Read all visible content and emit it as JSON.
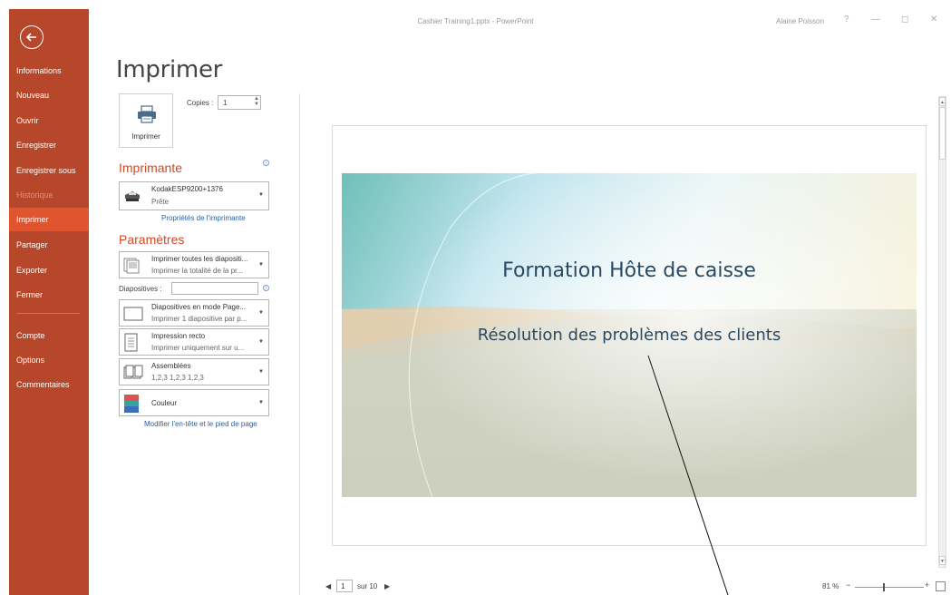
{
  "window": {
    "title": "Cashier Training1.pptx - PowerPoint",
    "user": "Alaine Poisson",
    "help": "?",
    "minimize": "—",
    "restore": "◻",
    "close": "✕"
  },
  "nav": {
    "items": [
      {
        "label": "Informations"
      },
      {
        "label": "Nouveau"
      },
      {
        "label": "Ouvrir"
      },
      {
        "label": "Enregistrer"
      },
      {
        "label": "Enregistrer sous"
      },
      {
        "label": "Historique"
      },
      {
        "label": "Imprimer"
      },
      {
        "label": "Partager"
      },
      {
        "label": "Exporter"
      },
      {
        "label": "Fermer"
      },
      {
        "label": "Compte"
      },
      {
        "label": "Options"
      },
      {
        "label": "Commentaires"
      }
    ]
  },
  "print": {
    "title": "Imprimer",
    "button_label": "Imprimer",
    "copies_label": "Copies :",
    "copies_value": "1"
  },
  "printer": {
    "section_title": "Imprimante",
    "name": "KodakESP9200+1376",
    "status": "Prête",
    "properties_link": "Propriétés de l'imprimante"
  },
  "settings": {
    "section_title": "Paramètres",
    "range_main": "Imprimer toutes les diapositi...",
    "range_sub": "Imprimer la totalité de la pr...",
    "slides_label": "Diapositives :",
    "layout_main": "Diapositives en mode Page...",
    "layout_sub": "Imprimer 1 diapositive par p...",
    "sides_main": "Impression recto",
    "sides_sub": "Imprimer uniquement sur u...",
    "collate_main": "Assemblées",
    "collate_sub": "1,2,3   1,2,3   1,2,3",
    "color_main": "Couleur",
    "header_footer_link": "Modifier l'en-tête et le pied de page"
  },
  "preview": {
    "slide_title": "Formation Hôte de caisse",
    "slide_subtitle": "Résolution des problèmes des clients",
    "page_current": "1",
    "page_of": "sur 10",
    "prev": "◀",
    "next": "▶",
    "zoom": "81 %",
    "zoom_minus": "−",
    "zoom_plus": "+"
  },
  "colors": {
    "nav_bg": "#b7472a",
    "nav_active": "#e0542e",
    "accent": "#d24726",
    "link": "#2a5fa0"
  }
}
